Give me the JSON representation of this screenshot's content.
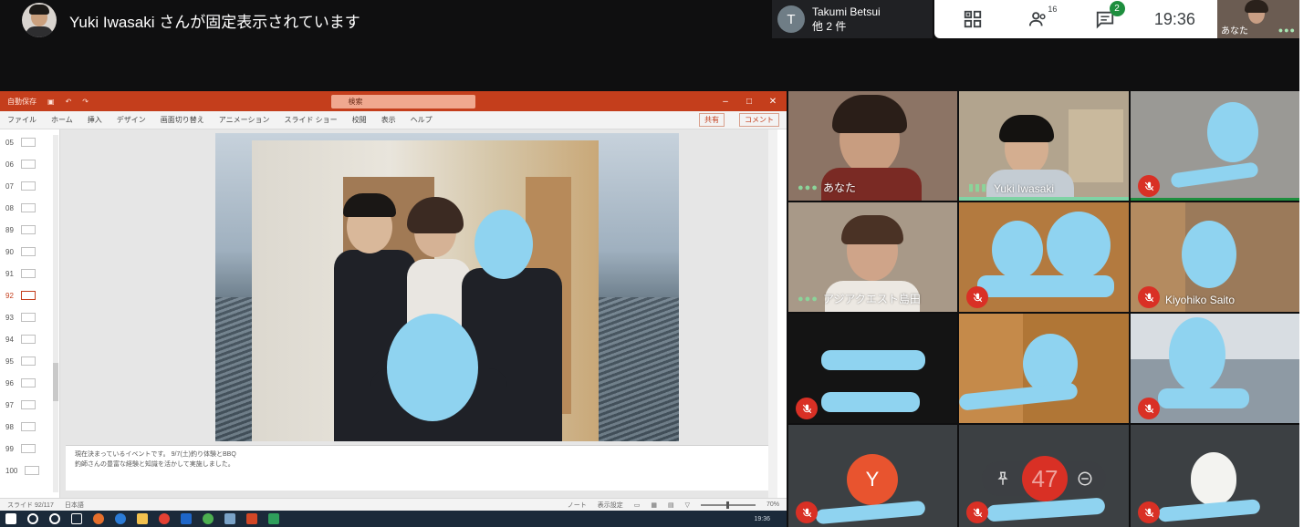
{
  "top_bar": {
    "pinned_text": "Yuki Iwasaki さんが固定表示されています",
    "presenter_initial": "T",
    "presenter_name": "Takumi Betsui",
    "presenter_others": "他 2 件",
    "people_count": "16",
    "chat_badge": "2",
    "time": "19:36",
    "self_label": "あなた"
  },
  "ppt": {
    "autosave_label": "自動保存",
    "search_placeholder": "検索",
    "menu_tabs": [
      "ファイル",
      "ホーム",
      "挿入",
      "デザイン",
      "画面切り替え",
      "アニメーション",
      "スライド ショー",
      "校閲",
      "表示",
      "ヘルプ"
    ],
    "share_label": "共有",
    "comment_label": "コメント",
    "slide_numbers": [
      "05",
      "06",
      "07",
      "08",
      "89",
      "90",
      "91",
      "92",
      "93",
      "94",
      "95",
      "96",
      "97",
      "98",
      "99",
      "100"
    ],
    "active_slide": "92",
    "notes_line1": "現在決まっているイベントです。 9/7(土)釣り体験とBBQ",
    "notes_line2": "釣師さんの豊富な経験と知識を活かして実施しました。",
    "status_left": "スライド 92/117",
    "status_lang": "日本語",
    "status_notes": "ノート",
    "status_view": "表示設定",
    "status_zoom": "70%",
    "taskbar_time": "19:36"
  },
  "participants": [
    {
      "name": "あなた",
      "muted": false,
      "speaking": false
    },
    {
      "name": "Yuki Iwasaki",
      "muted": false,
      "speaking": true
    },
    {
      "name": "",
      "muted": true,
      "speaking": false
    },
    {
      "name": "アジアクエスト島田",
      "muted": false,
      "speaking": false
    },
    {
      "name": "",
      "muted": true,
      "speaking": false
    },
    {
      "name": "Kiyohiko Saito",
      "muted": true,
      "speaking": false
    },
    {
      "name": "",
      "muted": true,
      "speaking": false
    },
    {
      "name": "",
      "muted": true,
      "speaking": false
    },
    {
      "name": "",
      "muted": true,
      "speaking": false
    },
    {
      "name": "",
      "muted": true,
      "speaking": false,
      "avatar_letter": "Y",
      "avatar_color": "#e8542f"
    },
    {
      "name": "",
      "muted": true,
      "speaking": false
    },
    {
      "name": "",
      "muted": true,
      "speaking": false
    }
  ],
  "hover_count": "47",
  "colors": {
    "muted_red": "#d93025",
    "green_badge": "#1e8e3e",
    "ppt_accent": "#c43e1c",
    "redaction_blue": "#8fd3f0"
  }
}
